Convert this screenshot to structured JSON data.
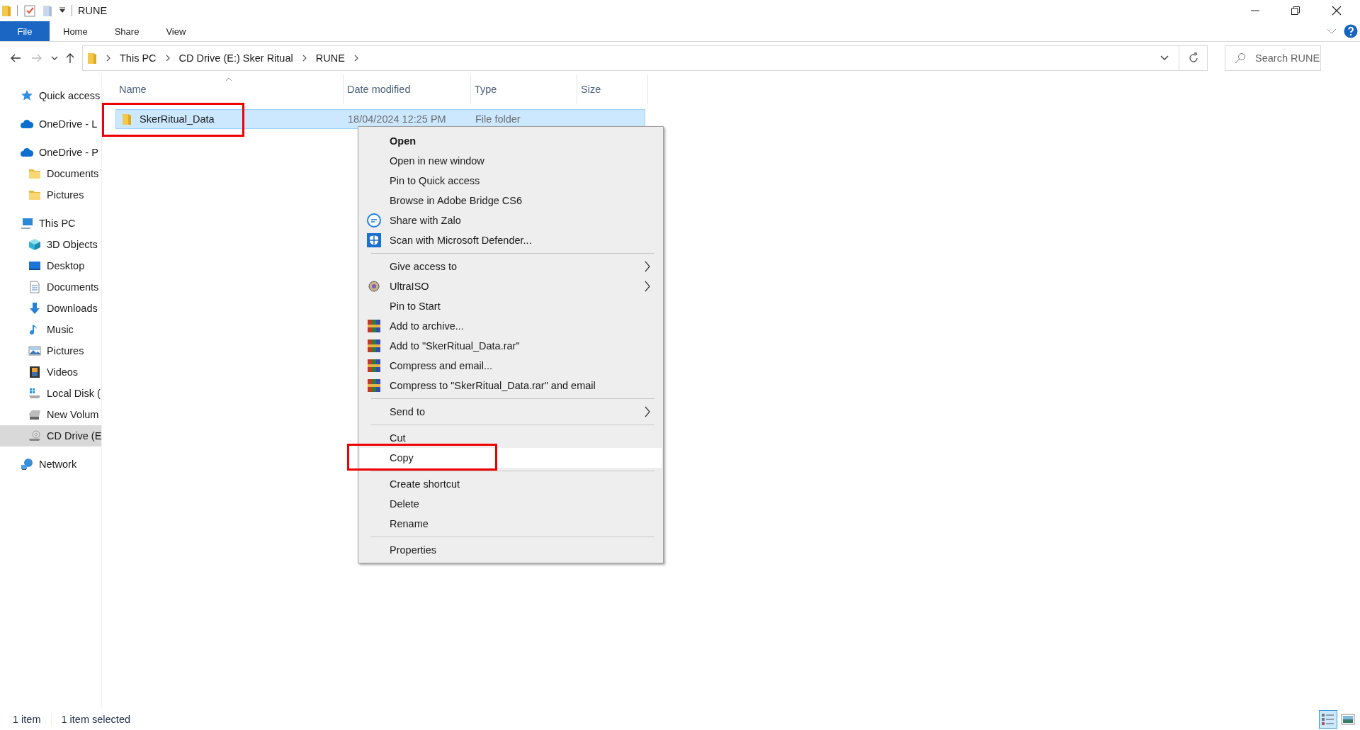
{
  "window": {
    "title": "RUNE"
  },
  "ribbon": {
    "tabs": [
      {
        "label": "File",
        "kind": "file"
      },
      {
        "label": "Home",
        "kind": "tab"
      },
      {
        "label": "Share",
        "kind": "tab"
      },
      {
        "label": "View",
        "kind": "tab"
      }
    ]
  },
  "address_bar": {
    "path": [
      "This PC",
      "CD Drive (E:) Sker Ritual",
      "RUNE"
    ]
  },
  "search": {
    "placeholder": "Search RUNE"
  },
  "sidebar": {
    "items": [
      {
        "label": "Quick access",
        "kind": "star",
        "selected": false
      },
      {
        "label": "OneDrive - L",
        "kind": "cloud",
        "selected": false
      },
      {
        "label": "OneDrive - P",
        "kind": "cloud",
        "selected": false,
        "children": [
          {
            "label": "Documents",
            "kind": "folder",
            "selected": false
          },
          {
            "label": "Pictures",
            "kind": "folder",
            "selected": false
          }
        ]
      },
      {
        "label": "This PC",
        "kind": "pc",
        "selected": false,
        "children": [
          {
            "label": "3D Objects",
            "kind": "cube",
            "selected": false
          },
          {
            "label": "Desktop",
            "kind": "desktop",
            "selected": false
          },
          {
            "label": "Documents",
            "kind": "document",
            "selected": false
          },
          {
            "label": "Downloads",
            "kind": "download",
            "selected": false
          },
          {
            "label": "Music",
            "kind": "music",
            "selected": false
          },
          {
            "label": "Pictures",
            "kind": "image",
            "selected": false
          },
          {
            "label": "Videos",
            "kind": "film",
            "selected": false
          },
          {
            "label": "Local Disk (",
            "kind": "windisk",
            "selected": false
          },
          {
            "label": "New Volum",
            "kind": "disk",
            "selected": false
          },
          {
            "label": "CD Drive (E",
            "kind": "cd",
            "selected": true
          }
        ]
      },
      {
        "label": "Network",
        "kind": "network",
        "selected": false
      }
    ]
  },
  "table": {
    "columns": [
      "Name",
      "Date modified",
      "Type",
      "Size"
    ],
    "rows": [
      {
        "name": "SkerRitual_Data",
        "date_modified": "18/04/2024 12:25 PM",
        "type": "File folder",
        "selected": true,
        "highlighted": true
      }
    ]
  },
  "context_menu": {
    "groups": [
      [
        {
          "label": "Open",
          "kind": "plain",
          "default": true,
          "submenu": false,
          "selected": false,
          "highlighted": false
        },
        {
          "label": "Open in new window",
          "kind": "plain",
          "default": false,
          "submenu": false,
          "selected": false,
          "highlighted": false
        },
        {
          "label": "Pin to Quick access",
          "kind": "plain",
          "default": false,
          "submenu": false,
          "selected": false,
          "highlighted": false
        },
        {
          "label": "Browse in Adobe Bridge CS6",
          "kind": "plain",
          "default": false,
          "submenu": false,
          "selected": false,
          "highlighted": false
        },
        {
          "label": "Share with Zalo",
          "kind": "zalo",
          "default": false,
          "submenu": false,
          "selected": false,
          "highlighted": false
        },
        {
          "label": "Scan with Microsoft Defender...",
          "kind": "defender",
          "default": false,
          "submenu": false,
          "selected": false,
          "highlighted": false
        }
      ],
      [
        {
          "label": "Give access to",
          "kind": "plain",
          "default": false,
          "submenu": true,
          "selected": false,
          "highlighted": false
        },
        {
          "label": "UltraISO",
          "kind": "ultraiso",
          "default": false,
          "submenu": true,
          "selected": false,
          "highlighted": false
        },
        {
          "label": "Pin to Start",
          "kind": "plain",
          "default": false,
          "submenu": false,
          "selected": false,
          "highlighted": false
        },
        {
          "label": "Add to archive...",
          "kind": "winrar",
          "default": false,
          "submenu": false,
          "selected": false,
          "highlighted": false
        },
        {
          "label": "Add to \"SkerRitual_Data.rar\"",
          "kind": "winrar",
          "default": false,
          "submenu": false,
          "selected": false,
          "highlighted": false
        },
        {
          "label": "Compress and email...",
          "kind": "winrar",
          "default": false,
          "submenu": false,
          "selected": false,
          "highlighted": false
        },
        {
          "label": "Compress to \"SkerRitual_Data.rar\" and email",
          "kind": "winrar",
          "default": false,
          "submenu": false,
          "selected": false,
          "highlighted": false
        }
      ],
      [
        {
          "label": "Send to",
          "kind": "plain",
          "default": false,
          "submenu": true,
          "selected": false,
          "highlighted": false
        }
      ],
      [
        {
          "label": "Cut",
          "kind": "plain",
          "default": false,
          "submenu": false,
          "selected": false,
          "highlighted": false
        },
        {
          "label": "Copy",
          "kind": "plain",
          "default": false,
          "submenu": false,
          "selected": true,
          "highlighted": true
        }
      ],
      [
        {
          "label": "Create shortcut",
          "kind": "plain",
          "default": false,
          "submenu": false,
          "selected": false,
          "highlighted": false
        },
        {
          "label": "Delete",
          "kind": "plain",
          "default": false,
          "submenu": false,
          "selected": false,
          "highlighted": false
        },
        {
          "label": "Rename",
          "kind": "plain",
          "default": false,
          "submenu": false,
          "selected": false,
          "highlighted": false
        }
      ],
      [
        {
          "label": "Properties",
          "kind": "plain",
          "default": false,
          "submenu": false,
          "selected": false,
          "highlighted": false
        }
      ]
    ]
  },
  "status_bar": {
    "item_count": "1 item",
    "selection": "1 item selected"
  },
  "view_buttons": [
    {
      "kind": "details",
      "selected": true
    },
    {
      "kind": "thumbnails",
      "selected": false
    }
  ]
}
